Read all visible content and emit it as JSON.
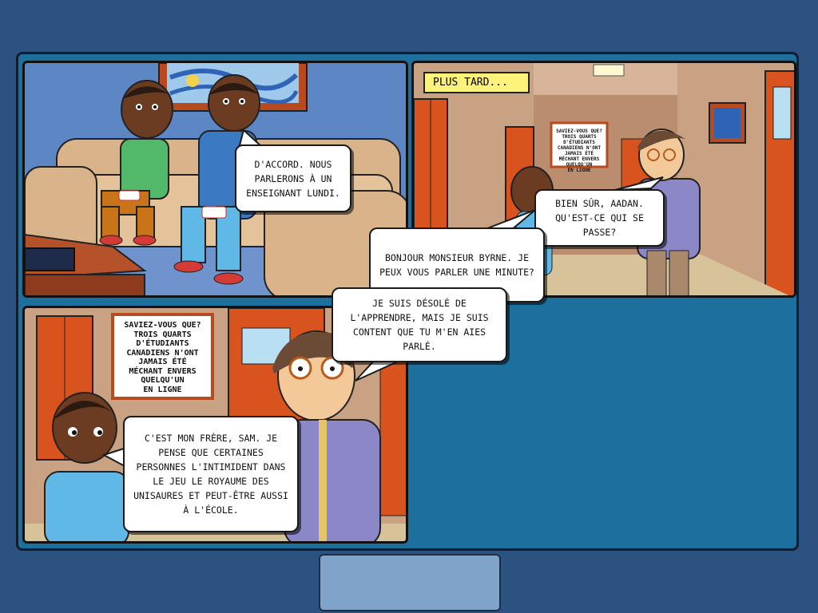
{
  "caption": {
    "text": "PLUS TARD..."
  },
  "bubbles": {
    "b1": "D'ACCORD. NOUS PARLERONS À UN ENSEIGNANT LUNDI.",
    "b2": "BIEN SÛR, AADAN. QU'EST-CE QUI SE PASSE?",
    "b3": "BONJOUR MONSIEUR BYRNE. JE PEUX VOUS PARLER UNE MINUTE?",
    "b4": "JE SUIS DÉSOLÉ DE L'APPRENDRE, MAIS JE SUIS CONTENT QUE TU M'EN AIES PARLÉ.",
    "b5": "C'EST MON FRÈRE, SAM. JE PENSE QUE CERTAINES PERSONNES L'INTIMIDENT DANS LE JEU LE ROYAUME DES UNISAURES ET PEUT-ÊTRE AUSSI À L'ÉCOLE."
  },
  "poster": {
    "lines": [
      "SAVIEZ-VOUS QUE?",
      "TROIS QUARTS",
      "D'ÉTUDIANTS",
      "CANADIENS N'ONT",
      "JAMAIS ÉTÉ",
      "MÉCHANT ENVERS",
      "QUELQU'UN",
      "EN LIGNE"
    ]
  },
  "colors": {
    "page_bg": "#2c5282",
    "frame_bg": "#1d6f9e",
    "caption_bg": "#fdf27a",
    "bottom_box": "#7fa3c9"
  }
}
